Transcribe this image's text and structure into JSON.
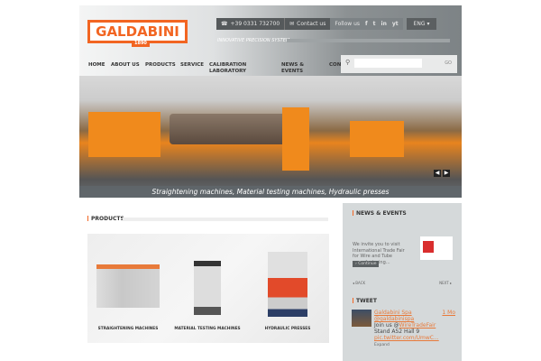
{
  "header": {
    "logo": "GALDABINI",
    "logo_year": "1890",
    "phone": "+39 0331 732700",
    "contact": "Contact us",
    "follow": "Follow us",
    "social": [
      "f",
      "t",
      "in",
      "yt"
    ],
    "lang": "ENG ▾",
    "tagline": "INNOVATIVE PRECISION SYSTEM"
  },
  "nav": [
    "HOME",
    "ABOUT US",
    "PRODUCTS",
    "SERVICE",
    "CALIBRATION LABORATORY",
    "NEWS & EVENTS",
    "CON"
  ],
  "search": {
    "placeholder": "",
    "go": "GO"
  },
  "hero": {
    "caption": "Straightening machines, Material testing machines, Hydraulic presses",
    "prev": "◀",
    "next": "▶"
  },
  "products": {
    "title": "PRODUCTS",
    "items": [
      "STRAIGHTENING MACHINES",
      "MATERIAL TESTING MACHINES",
      "HYDRAULIC PRESSES"
    ]
  },
  "news": {
    "title": "NEWS & EVENTS",
    "text": "We invite you to visit International Trade Fair for Wire and Tube manufacturing...",
    "continue": "› Continue",
    "back": "◂ BACK",
    "next": "NEXT ▸"
  },
  "tweet": {
    "title": "TWEET",
    "name": "Galdabini Spa",
    "handle": "@galdabinispa",
    "time": "1 Mo",
    "text1": "Join us @",
    "mention": "WireTradeFair",
    "text2": "Stand A52 Hall 9",
    "link": "pic.twitter.com/UmwC...",
    "expand": "Expand"
  },
  "colors": {
    "accent": "#f26522"
  }
}
